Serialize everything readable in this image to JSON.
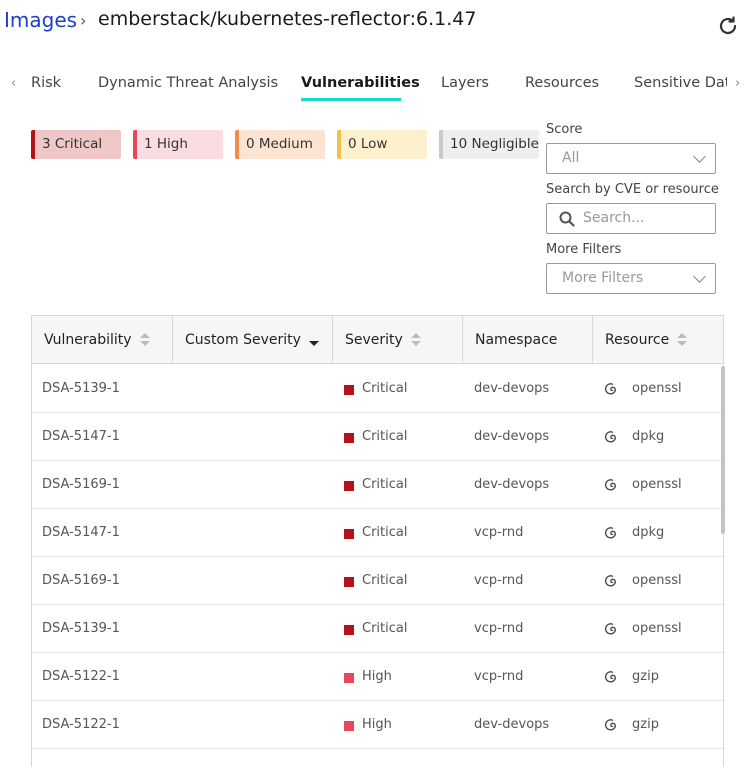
{
  "breadcrumb": {
    "root": "Images",
    "separator": "›",
    "current": "emberstack/kubernetes-reflector:6.1.47"
  },
  "tabs": [
    {
      "label": "Risk"
    },
    {
      "label": "Dynamic Threat Analysis"
    },
    {
      "label": "Vulnerabilities"
    },
    {
      "label": "Layers"
    },
    {
      "label": "Resources"
    },
    {
      "label": "Sensitive Data"
    }
  ],
  "severity_badges": [
    {
      "label": "3 Critical",
      "bar": "#b3121a",
      "bg": "#f0c7c7"
    },
    {
      "label": "1 High",
      "bar": "#e8475a",
      "bg": "#fadde2"
    },
    {
      "label": "0 Medium",
      "bar": "#f08c4c",
      "bg": "#fde3d2"
    },
    {
      "label": "0 Low",
      "bar": "#f4bf46",
      "bg": "#fdf1cd"
    },
    {
      "label": "10 Negligible",
      "bar": "#c9c9c9",
      "bg": "#eeeeee"
    }
  ],
  "filters": {
    "score_label": "Score",
    "score_value": "All",
    "search_label": "Search by CVE or resource",
    "search_placeholder": "Search...",
    "more_label": "More Filters",
    "more_value": "More Filters"
  },
  "table": {
    "columns": [
      "Vulnerability",
      "Custom Severity",
      "Severity",
      "Namespace",
      "Resource"
    ],
    "rows": [
      {
        "vuln": "DSA-5139-1",
        "custom": "",
        "severity": "Critical",
        "namespace": "dev-devops",
        "resource": "openssl"
      },
      {
        "vuln": "DSA-5147-1",
        "custom": "",
        "severity": "Critical",
        "namespace": "dev-devops",
        "resource": "dpkg"
      },
      {
        "vuln": "DSA-5169-1",
        "custom": "",
        "severity": "Critical",
        "namespace": "dev-devops",
        "resource": "openssl"
      },
      {
        "vuln": "DSA-5147-1",
        "custom": "",
        "severity": "Critical",
        "namespace": "vcp-rnd",
        "resource": "dpkg"
      },
      {
        "vuln": "DSA-5169-1",
        "custom": "",
        "severity": "Critical",
        "namespace": "vcp-rnd",
        "resource": "openssl"
      },
      {
        "vuln": "DSA-5139-1",
        "custom": "",
        "severity": "Critical",
        "namespace": "vcp-rnd",
        "resource": "openssl"
      },
      {
        "vuln": "DSA-5122-1",
        "custom": "",
        "severity": "High",
        "namespace": "vcp-rnd",
        "resource": "gzip"
      },
      {
        "vuln": "DSA-5122-1",
        "custom": "",
        "severity": "High",
        "namespace": "dev-devops",
        "resource": "gzip"
      }
    ]
  },
  "colors": {
    "critical": "#b3121a",
    "high": "#e8475a",
    "accent": "#18d8d0",
    "link": "#1f3fc4"
  },
  "icons": {
    "refresh": "refresh-icon",
    "search": "search-icon",
    "resource": "debian-swirl-icon"
  }
}
